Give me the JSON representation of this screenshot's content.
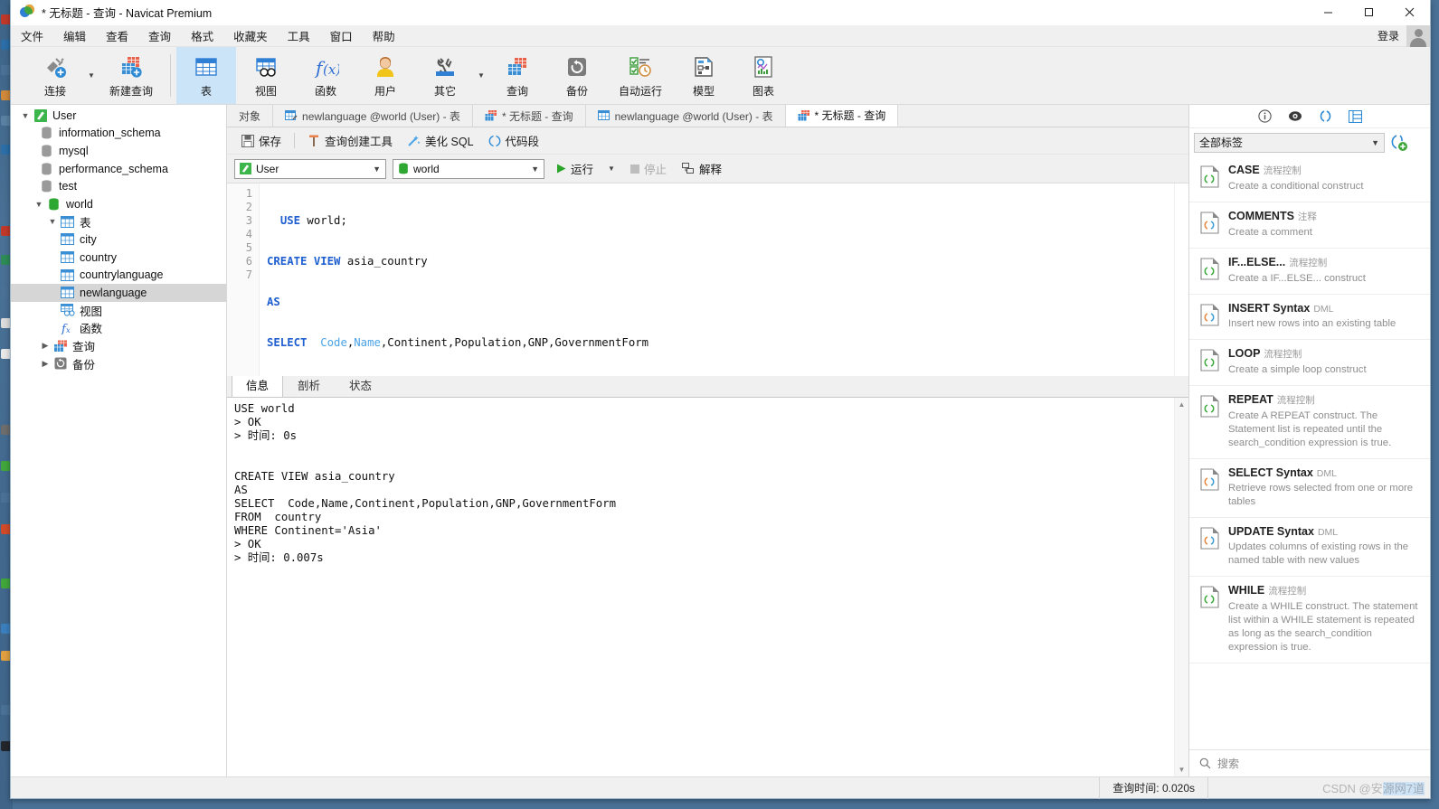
{
  "window": {
    "title": "* 无标题 - 查询 - Navicat Premium",
    "minimize_label": "minimize",
    "maximize_label": "maximize",
    "close_label": "close"
  },
  "menubar": {
    "items": [
      {
        "label": "文件"
      },
      {
        "label": "编辑"
      },
      {
        "label": "查看"
      },
      {
        "label": "查询"
      },
      {
        "label": "格式"
      },
      {
        "label": "收藏夹"
      },
      {
        "label": "工具"
      },
      {
        "label": "窗口"
      },
      {
        "label": "帮助"
      }
    ],
    "login_label": "登录"
  },
  "ribbon": {
    "buttons": [
      {
        "label": "连接",
        "icon": "connection-icon",
        "has_caret": true
      },
      {
        "label": "新建查询",
        "icon": "new-query-icon",
        "has_caret": false
      },
      {
        "label": "表",
        "icon": "table-icon",
        "active": true
      },
      {
        "label": "视图",
        "icon": "view-icon"
      },
      {
        "label": "函数",
        "icon": "function-icon"
      },
      {
        "label": "用户",
        "icon": "user-icon"
      },
      {
        "label": "其它",
        "icon": "others-icon",
        "has_caret": true
      },
      {
        "label": "查询",
        "icon": "query-icon"
      },
      {
        "label": "备份",
        "icon": "backup-icon"
      },
      {
        "label": "自动运行",
        "icon": "automation-icon"
      },
      {
        "label": "模型",
        "icon": "model-icon"
      },
      {
        "label": "图表",
        "icon": "chart-icon"
      }
    ]
  },
  "tree": [
    {
      "label": "User",
      "icon": "connection-green-icon",
      "depth": 0,
      "twist": "expanded"
    },
    {
      "label": "information_schema",
      "icon": "database-gray-icon",
      "depth": 1,
      "twist": "none"
    },
    {
      "label": "mysql",
      "icon": "database-gray-icon",
      "depth": 1,
      "twist": "none"
    },
    {
      "label": "performance_schema",
      "icon": "database-gray-icon",
      "depth": 1,
      "twist": "none"
    },
    {
      "label": "test",
      "icon": "database-gray-icon",
      "depth": 1,
      "twist": "none"
    },
    {
      "label": "world",
      "icon": "database-green-icon",
      "depth": 1,
      "twist": "expanded"
    },
    {
      "label": "表",
      "icon": "table-icon",
      "depth": 2,
      "twist": "expanded"
    },
    {
      "label": "city",
      "icon": "table-icon",
      "depth": 3,
      "twist": "none"
    },
    {
      "label": "country",
      "icon": "table-icon",
      "depth": 3,
      "twist": "none"
    },
    {
      "label": "countrylanguage",
      "icon": "table-icon",
      "depth": 3,
      "twist": "none"
    },
    {
      "label": "newlanguage",
      "icon": "table-icon",
      "depth": 3,
      "twist": "none",
      "selected": true
    },
    {
      "label": "视图",
      "icon": "view-icon",
      "depth": 2,
      "twist": "none"
    },
    {
      "label": "函数",
      "icon": "function-icon",
      "depth": 2,
      "twist": "none"
    },
    {
      "label": "查询",
      "icon": "query-icon",
      "depth": 2,
      "twist": "collapsed"
    },
    {
      "label": "备份",
      "icon": "backup-icon",
      "depth": 2,
      "twist": "collapsed"
    }
  ],
  "tabs": [
    {
      "label": "对象",
      "icon": "none",
      "active": false
    },
    {
      "label": "newlanguage @world (User) - 表",
      "icon": "table-edit-icon",
      "active": false
    },
    {
      "label": "* 无标题 - 查询",
      "icon": "query-red-icon",
      "active": false
    },
    {
      "label": "newlanguage @world (User) - 表",
      "icon": "table-icon",
      "active": false
    },
    {
      "label": "* 无标题 - 查询",
      "icon": "query-red-icon",
      "active": true
    }
  ],
  "query_toolbar": {
    "save_label": "保存",
    "builder_label": "查询创建工具",
    "beautify_label": "美化 SQL",
    "snippet_label": "代码段"
  },
  "connection_bar": {
    "connection_value": "User",
    "database_value": "world",
    "run_label": "运行",
    "stop_label": "停止",
    "explain_label": "解释"
  },
  "editor": {
    "line_numbers": [
      "1",
      "2",
      "3",
      "4",
      "5",
      "6",
      "7"
    ],
    "lines": [
      [
        {
          "t": "  ",
          "c": "plain"
        },
        {
          "t": "USE",
          "c": "kw"
        },
        {
          "t": " world;",
          "c": "plain"
        }
      ],
      [
        {
          "t": "CREATE VIEW",
          "c": "kw"
        },
        {
          "t": " asia_country",
          "c": "plain"
        }
      ],
      [
        {
          "t": "AS",
          "c": "kw"
        }
      ],
      [
        {
          "t": "SELECT",
          "c": "kw"
        },
        {
          "t": "  ",
          "c": "plain"
        },
        {
          "t": "Code",
          "c": "col"
        },
        {
          "t": ",",
          "c": "plain"
        },
        {
          "t": "Name",
          "c": "col"
        },
        {
          "t": ",Continent,Population,GNP,GovernmentForm",
          "c": "plain"
        }
      ],
      [
        {
          "t": "FROM",
          "c": "kw"
        },
        {
          "t": "  country",
          "c": "plain"
        }
      ],
      [
        {
          "t": "WHERE",
          "c": "kw"
        },
        {
          "t": " Continent=",
          "c": "plain"
        },
        {
          "t": "'Asia'",
          "c": "str"
        },
        {
          "t": ";",
          "c": "plain"
        }
      ],
      []
    ],
    "raw_sql": "  USE world;\nCREATE VIEW asia_country\nAS\nSELECT  Code,Name,Continent,Population,GNP,GovernmentForm\nFROM  country\nWHERE Continent='Asia';\n"
  },
  "results": {
    "tabs": [
      {
        "label": "信息",
        "active": true
      },
      {
        "label": "剖析",
        "active": false
      },
      {
        "label": "状态",
        "active": false
      }
    ],
    "log": "USE world\n> OK\n> 时间: 0s\n\n\nCREATE VIEW asia_country\nAS\nSELECT  Code,Name,Continent,Population,GNP,GovernmentForm\nFROM  country\nWHERE Continent='Asia'\n> OK\n> 时间: 0.007s"
  },
  "right_panel": {
    "icons": [
      {
        "name": "info-icon"
      },
      {
        "name": "preview-eye-icon"
      },
      {
        "name": "snippet-parens-icon",
        "active": true
      },
      {
        "name": "structure-icon"
      }
    ],
    "filter_value": "全部标签",
    "add_snippet_label": "add-snippet",
    "search_placeholder": "搜索",
    "snippets": [
      {
        "title": "CASE",
        "tag": "流程控制",
        "desc": "Create a conditional construct",
        "icon_color": "green"
      },
      {
        "title": "COMMENTS",
        "tag": "注释",
        "desc": "Create a comment",
        "icon_color": "orange"
      },
      {
        "title": "IF...ELSE...",
        "tag": "流程控制",
        "desc": "Create a IF...ELSE... construct",
        "icon_color": "green"
      },
      {
        "title": "INSERT Syntax",
        "tag": "DML",
        "desc": "Insert new rows into an existing table",
        "icon_color": "orange"
      },
      {
        "title": "LOOP",
        "tag": "流程控制",
        "desc": "Create a simple loop construct",
        "icon_color": "green"
      },
      {
        "title": "REPEAT",
        "tag": "流程控制",
        "desc": "Create A REPEAT construct. The Statement list is repeated until the search_condition expression is true.",
        "icon_color": "green"
      },
      {
        "title": "SELECT Syntax",
        "tag": "DML",
        "desc": "Retrieve rows selected from one or more tables",
        "icon_color": "orange"
      },
      {
        "title": "UPDATE Syntax",
        "tag": "DML",
        "desc": "Updates columns of existing rows in the named table with new values",
        "icon_color": "orange"
      },
      {
        "title": "WHILE",
        "tag": "流程控制",
        "desc": "Create a WHILE construct. The statement list within a WHILE statement is repeated as long as the search_condition expression is true.",
        "icon_color": "green"
      }
    ]
  },
  "statusbar": {
    "query_time": "查询时间: 0.020s",
    "watermark_prefix": "CSDN @安",
    "watermark_selected": "源网7道"
  },
  "colors": {
    "accent_blue": "#2f7fd4",
    "keyword_blue": "#1f5fd0",
    "column_blue": "#4aa3e8",
    "string_red": "#e03a3a",
    "ribbon_active": "#cbe4f8",
    "tree_selected": "#d6d6d6",
    "green": "#41a63c"
  }
}
